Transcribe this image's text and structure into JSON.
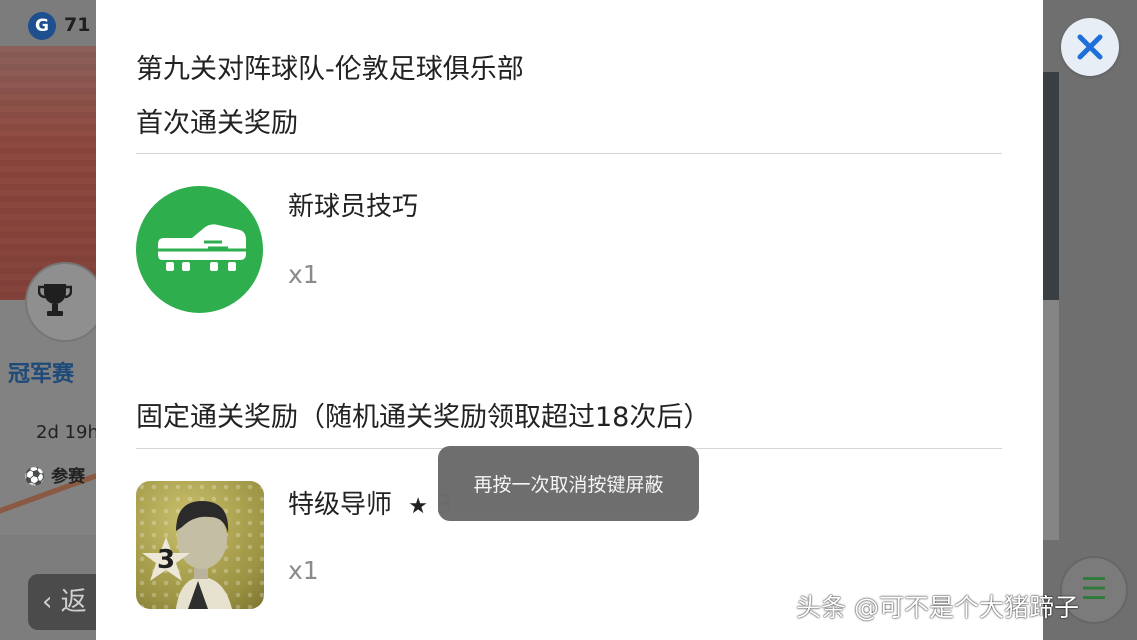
{
  "background": {
    "top_left_count": "71",
    "cup_label": "冠军赛",
    "countdown": "2d 19h",
    "enter_label": "参赛",
    "back_label": "返"
  },
  "modal": {
    "title": "第九关对阵球队-伦敦足球俱乐部",
    "first_clear_heading": "首次通关奖励",
    "first_reward": {
      "name": "新球员技巧",
      "quantity": "x1",
      "icon": "football-boot-icon"
    },
    "fixed_clear_heading": "固定通关奖励（随机通关奖励领取超过18次后）",
    "fixed_reward": {
      "name": "特级导师",
      "star": "★",
      "level": "3",
      "quantity": "x1",
      "icon": "coach-portrait-icon"
    },
    "close_icon": "close-icon"
  },
  "toast": {
    "text": "再按一次取消按键屏蔽"
  },
  "watermark": {
    "text": "头条 @可不是个大猪蹄子"
  },
  "colors": {
    "close_blue": "#1e6fd9",
    "boot_green": "#2fae4e",
    "toast_bg": "#6a6a6a"
  }
}
